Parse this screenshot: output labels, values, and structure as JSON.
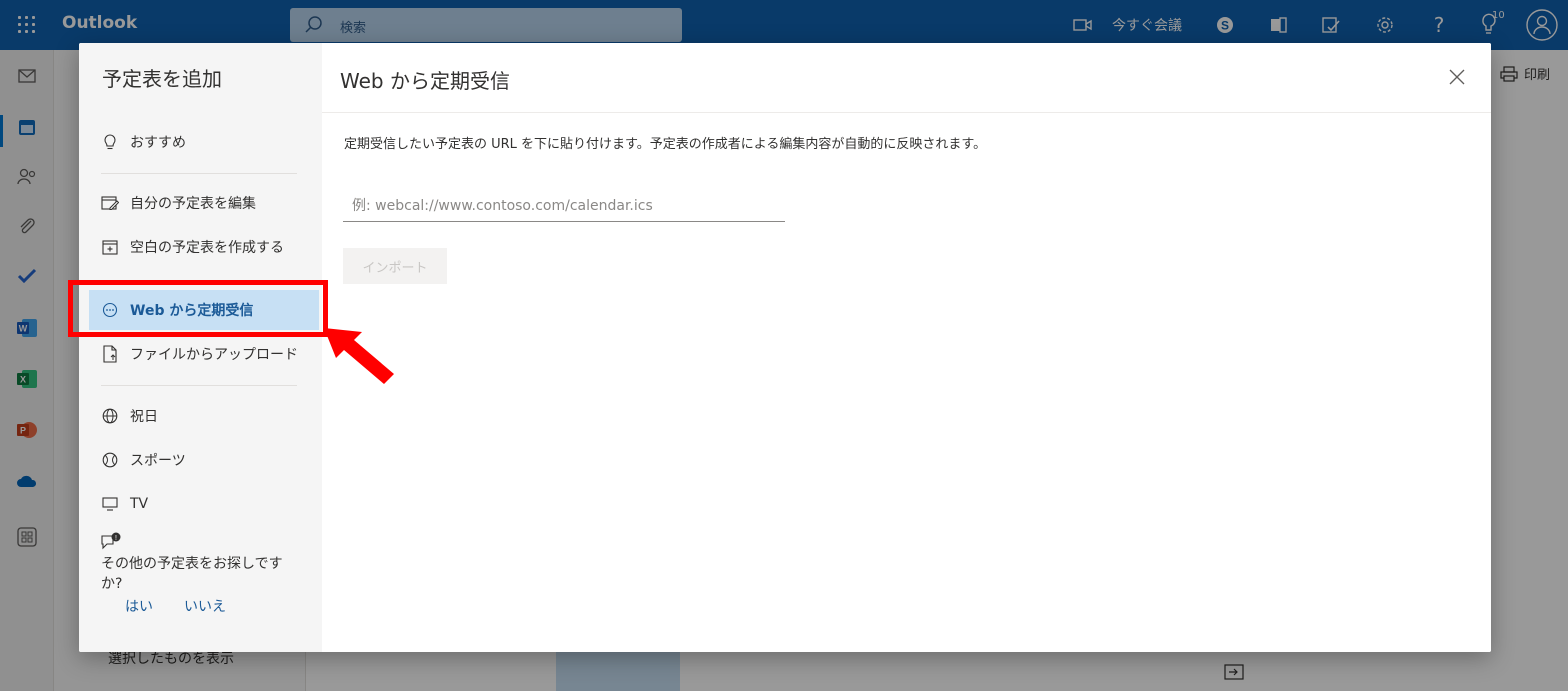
{
  "topbar": {
    "app_name": "Outlook",
    "search_placeholder": "検索",
    "meet_now_label": "今すぐ会議",
    "notification_count": "10",
    "icons": [
      "waffle-icon",
      "video-icon",
      "skype-icon",
      "office-icon",
      "feedback-icon",
      "settings-icon",
      "help-icon",
      "tips-icon",
      "avatar-icon"
    ]
  },
  "rail": {
    "icons": [
      "mail-icon",
      "calendar-icon",
      "people-icon",
      "attachment-icon",
      "todo-icon",
      "word-icon",
      "excel-icon",
      "powerpoint-icon",
      "onedrive-icon",
      "apps-icon"
    ]
  },
  "background": {
    "print_label": "印刷",
    "show_selected_label": "選択したものを表示"
  },
  "dialog": {
    "nav_title": "予定表を追加",
    "nav_items": [
      {
        "label": "おすすめ",
        "icon": "lightbulb-icon"
      },
      {
        "label": "自分の予定表を編集",
        "icon": "edit-calendar-icon"
      },
      {
        "label": "空白の予定表を作成する",
        "icon": "add-calendar-icon"
      },
      {
        "label": "Web から定期受信",
        "icon": "subscribe-icon",
        "active": true
      },
      {
        "label": "ファイルからアップロード",
        "icon": "upload-file-icon"
      },
      {
        "label": "祝日",
        "icon": "globe-icon"
      },
      {
        "label": "スポーツ",
        "icon": "sports-icon"
      },
      {
        "label": "TV",
        "icon": "tv-icon"
      }
    ],
    "ask_text": "その他の予定表をお探しですか?",
    "ask_yes": "はい",
    "ask_no": "いいえ",
    "title": "Web から定期受信",
    "description": "定期受信したい予定表の URL を下に貼り付けます。予定表の作成者による編集内容が自動的に反映されます。",
    "url_placeholder": "例: webcal://www.contoso.com/calendar.ics",
    "url_value": "",
    "import_label": "インポート"
  },
  "colors": {
    "brand": "#1061b0",
    "active_nav": "#c7e0f4",
    "link": "#1b5a97",
    "annotation": "#ff0000"
  }
}
